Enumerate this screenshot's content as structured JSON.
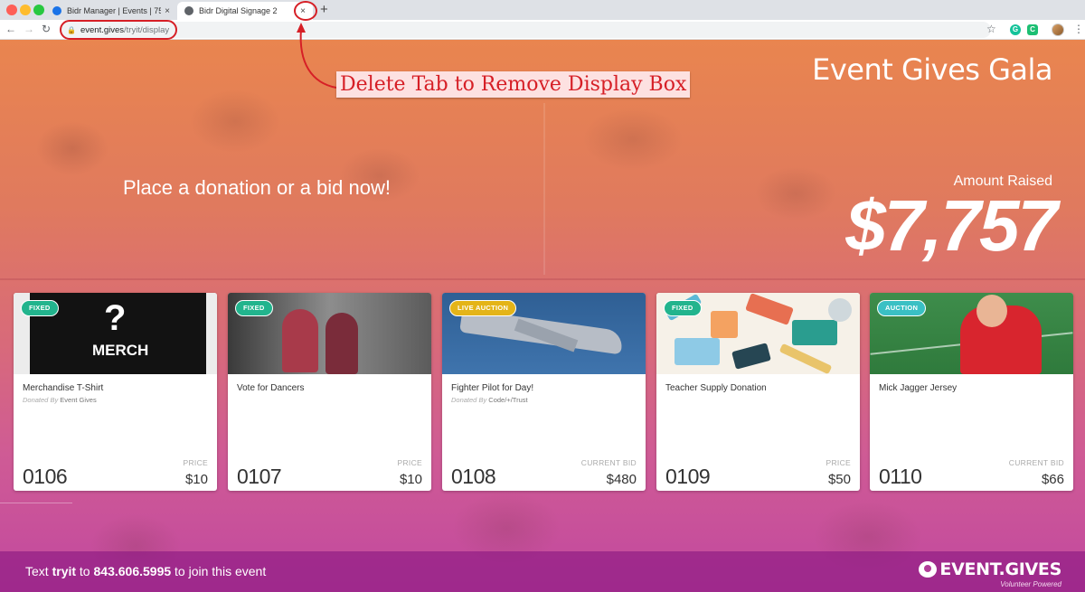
{
  "browser": {
    "tabs": [
      {
        "title": "Bidr Manager | Events | 75683",
        "close": "×"
      },
      {
        "title": "Bidr Digital Signage 2",
        "close": "×"
      }
    ],
    "new_tab": "+",
    "url_host": "event.gives",
    "url_path": "/tryit/display",
    "ext1_letter": "G",
    "ext2_letter": "C"
  },
  "signage": {
    "event_title": "Event Gives Gala",
    "tagline": "Place a donation or a bid now!",
    "amount_label": "Amount Raised",
    "amount_value": "$7,757"
  },
  "items": [
    {
      "badge": "FIXED",
      "name": "Merchandise T-Shirt",
      "donor_prefix": "Donated By",
      "donor": "Event Gives",
      "number": "0106",
      "price_label": "PRICE",
      "price": "$10",
      "image_text_q": "?",
      "image_text": "MERCH"
    },
    {
      "badge": "FIXED",
      "name": "Vote for Dancers",
      "number": "0107",
      "price_label": "PRICE",
      "price": "$10"
    },
    {
      "badge": "LIVE AUCTION",
      "name": "Fighter Pilot for Day!",
      "donor_prefix": "Donated By",
      "donor": "Code/+/Trust",
      "number": "0108",
      "price_label": "CURRENT BID",
      "price": "$480"
    },
    {
      "badge": "FIXED",
      "name": "Teacher Supply Donation",
      "number": "0109",
      "price_label": "PRICE",
      "price": "$50"
    },
    {
      "badge": "AUCTION",
      "name": "Mick Jagger Jersey",
      "number": "0110",
      "price_label": "CURRENT BID",
      "price": "$66"
    }
  ],
  "footer": {
    "text_prefix": "Text",
    "keyword": "tryit",
    "text_middle": "to",
    "phone": "843.606.5995",
    "text_suffix": "to join this event",
    "logo_text": "EVENT.GIVES",
    "logo_sub": "Volunteer Powered"
  },
  "annotation": {
    "label": "Delete Tab to Remove Display Box",
    "color": "#d61f26"
  },
  "colors": {
    "badge_fixed": "#22b48d",
    "badge_live": "#e4b418",
    "badge_auction": "#3ac0c4"
  }
}
